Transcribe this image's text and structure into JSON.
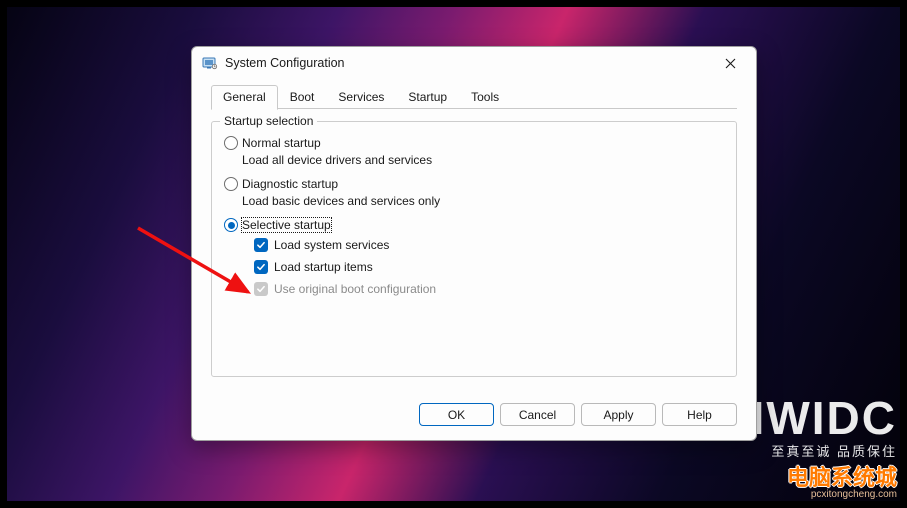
{
  "window": {
    "title": "System Configuration"
  },
  "tabs": {
    "general": "General",
    "boot": "Boot",
    "services": "Services",
    "startup": "Startup",
    "tools": "Tools"
  },
  "group": {
    "legend": "Startup selection",
    "normal": {
      "label": "Normal startup",
      "desc": "Load all device drivers and services"
    },
    "diagnostic": {
      "label": "Diagnostic startup",
      "desc": "Load basic devices and services only"
    },
    "selective": {
      "label": "Selective startup"
    },
    "check_sys": "Load system services",
    "check_start": "Load startup items",
    "check_origboot": "Use original boot configuration"
  },
  "buttons": {
    "ok": "OK",
    "cancel": "Cancel",
    "apply": "Apply",
    "help": "Help"
  },
  "watermark": {
    "big": "HWIDC",
    "cn1": "至真至诚 品质保住",
    "cn2": "电脑系统城",
    "cn3": "pcxitongcheng.com"
  }
}
